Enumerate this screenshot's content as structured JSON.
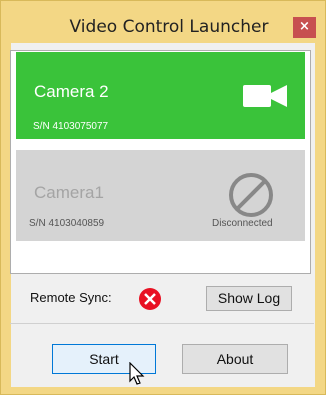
{
  "window": {
    "title": "Video Control Launcher",
    "close_glyph": "×"
  },
  "cameras": [
    {
      "name": "Camera 2",
      "serial": "S/N 4103075077",
      "status": "connected",
      "icon": "video-camera-icon",
      "color": "#3ac33a"
    },
    {
      "name": "Camera1",
      "serial": "S/N 4103040859",
      "status_label": "Disconnected",
      "icon": "disconnected-icon",
      "color": "#d4d4d4"
    }
  ],
  "sync": {
    "label": "Remote Sync:",
    "status_icon": "error-x-icon",
    "status_color": "#e81123"
  },
  "buttons": {
    "show_log": "Show Log",
    "start": "Start",
    "about": "About"
  }
}
